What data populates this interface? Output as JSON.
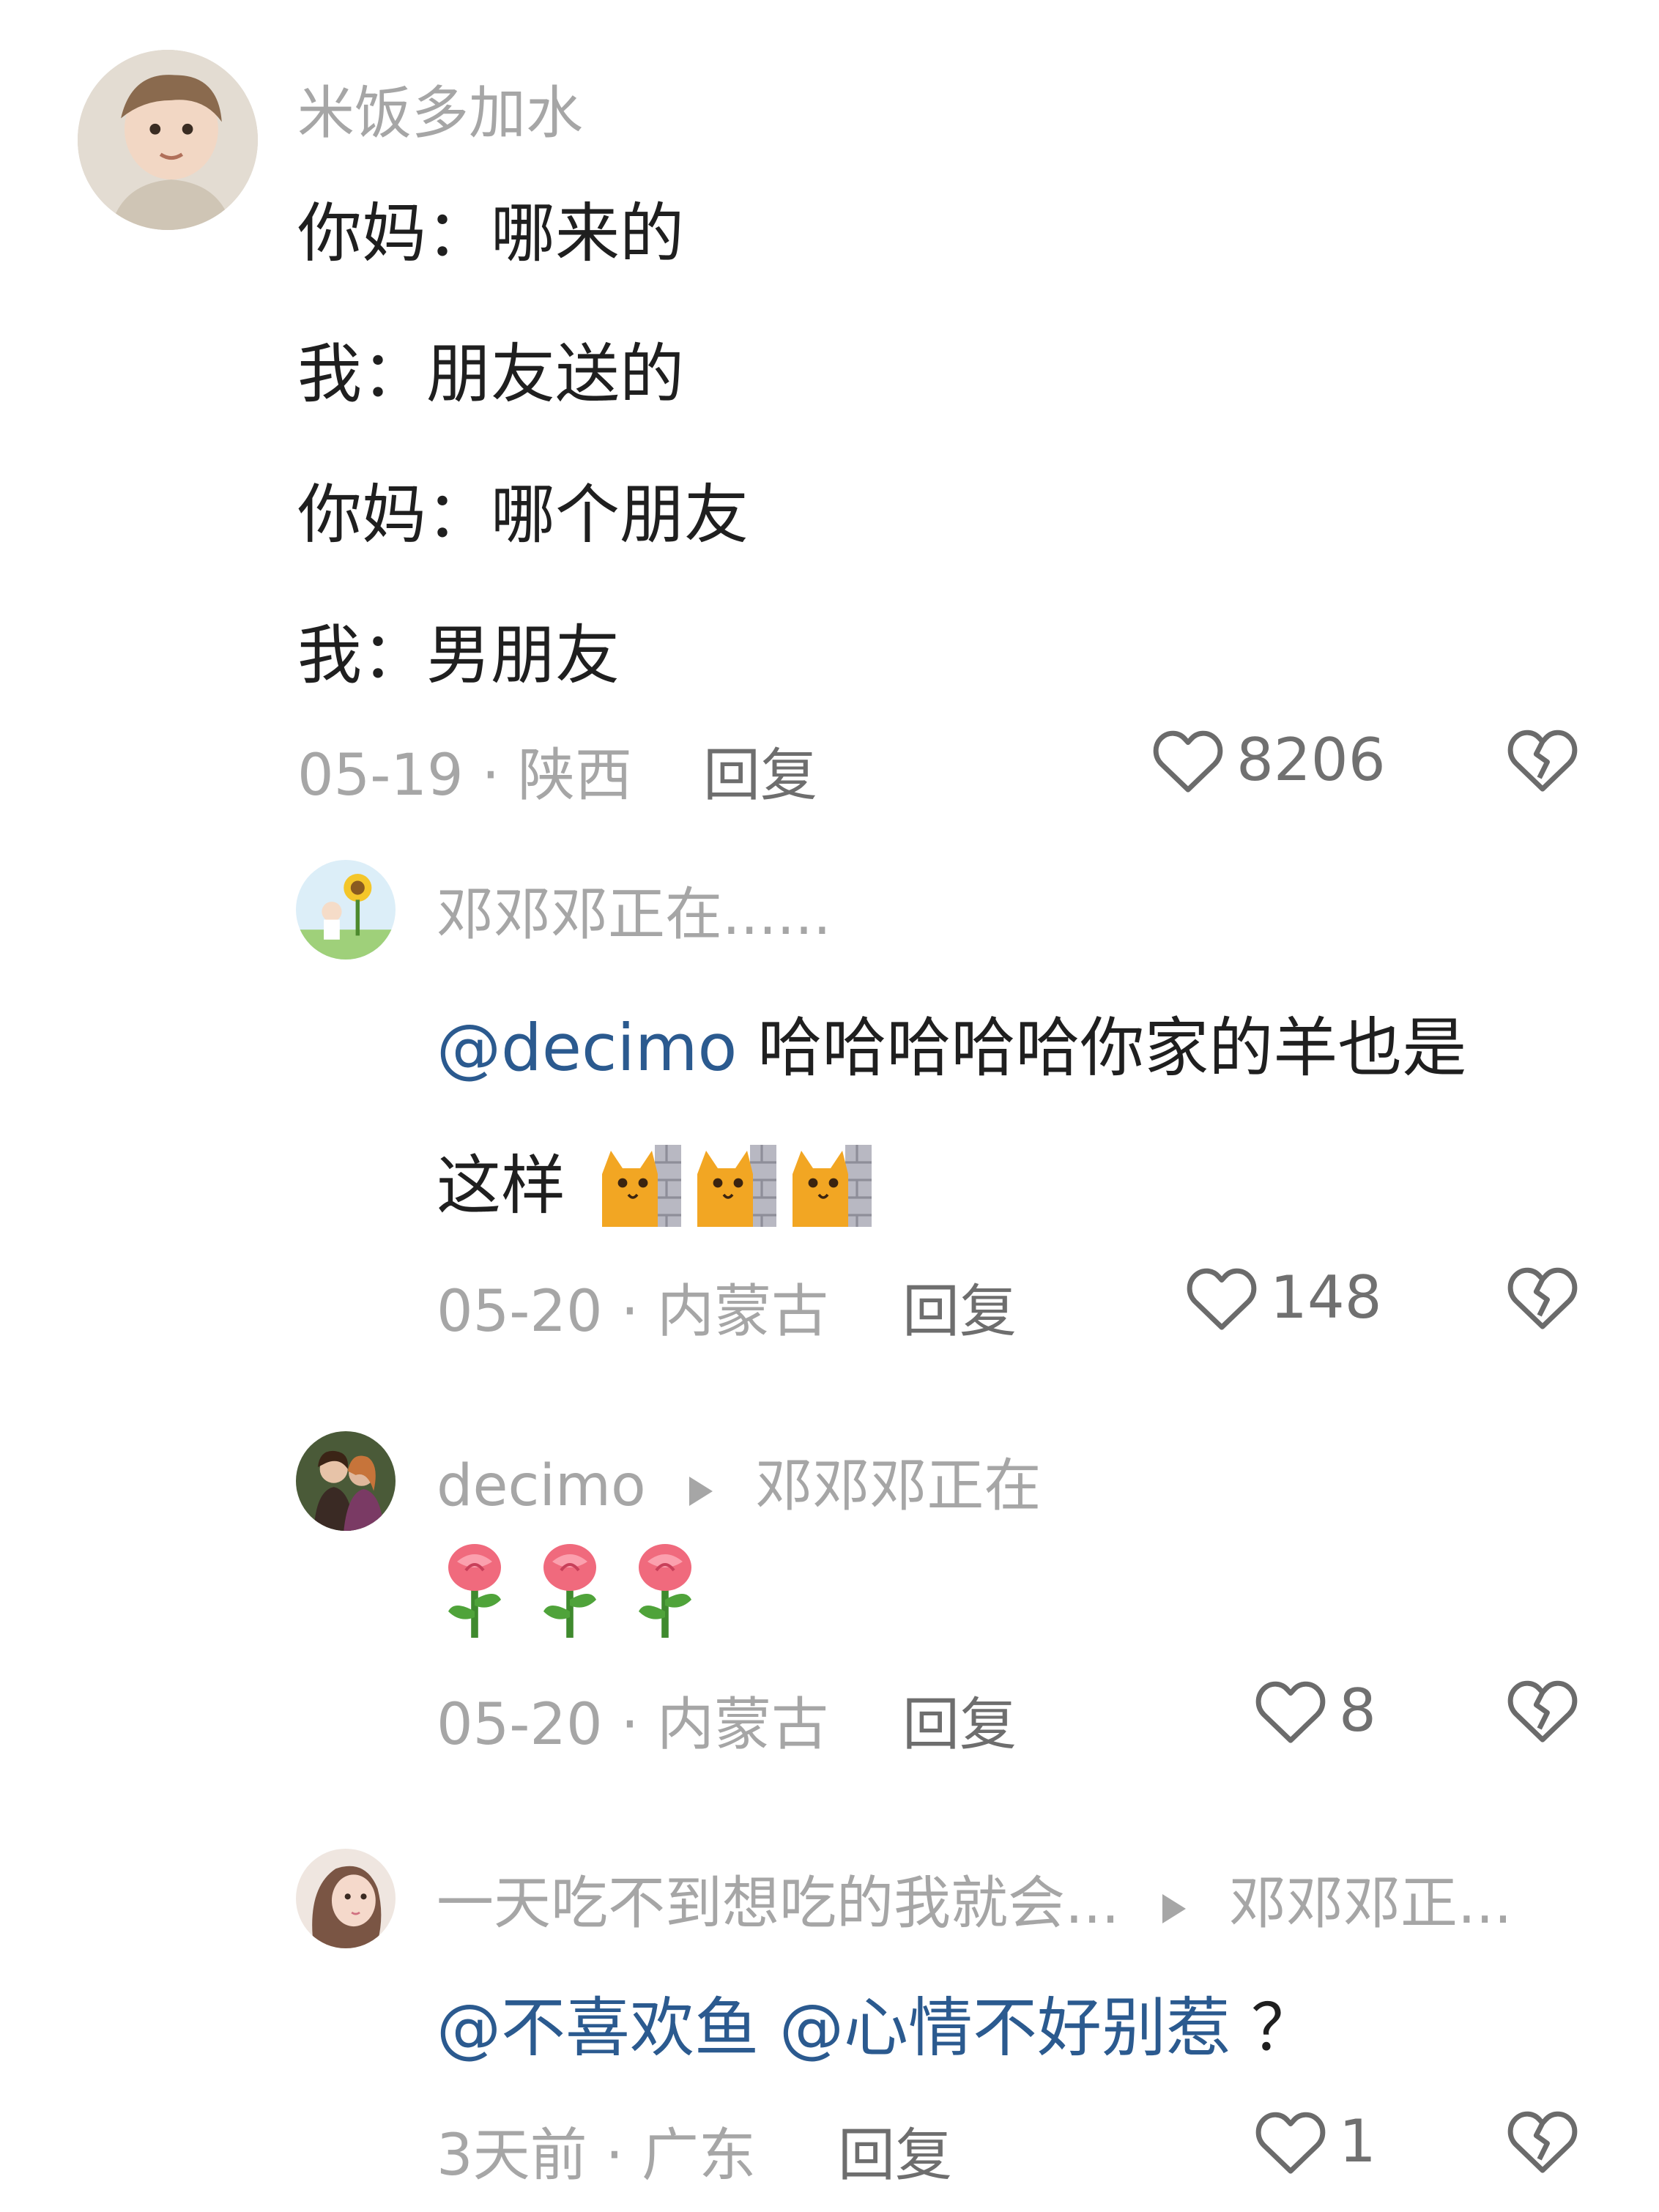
{
  "comments": [
    {
      "username": "米饭多加水",
      "lines": [
        "你妈：哪来的",
        "我：朋友送的",
        "你妈：哪个朋友",
        "我：男朋友"
      ],
      "date": "05-19",
      "location": "陕西",
      "reply_label": "回复",
      "likes": "8206"
    },
    {
      "username": "邓邓邓正在......",
      "mention": "@decimo",
      "text_line1": "哈哈哈哈哈你家的羊也是",
      "text_line2": "这样",
      "emoji_name": "cat-peeking-wall-emoji",
      "date": "05-20",
      "location": "内蒙古",
      "reply_label": "回复",
      "likes": "148"
    },
    {
      "username": "decimo",
      "reply_to": "邓邓邓正在",
      "emoji_name": "rose-emoji",
      "date": "05-20",
      "location": "内蒙古",
      "reply_label": "回复",
      "likes": "8"
    },
    {
      "username": "一天吃不到想吃的我就会...",
      "reply_to": "邓邓邓正...",
      "mention1": "@不喜欢鱼",
      "mention2": "@心情不好别惹",
      "tail": "？",
      "date": "3天前",
      "location": "广东",
      "reply_label": "回复",
      "likes": "1"
    }
  ],
  "separator": "·",
  "icons": {
    "like": "heart-outline-icon",
    "dislike": "broken-heart-icon",
    "reply_arrow": "triangle-right-icon"
  }
}
